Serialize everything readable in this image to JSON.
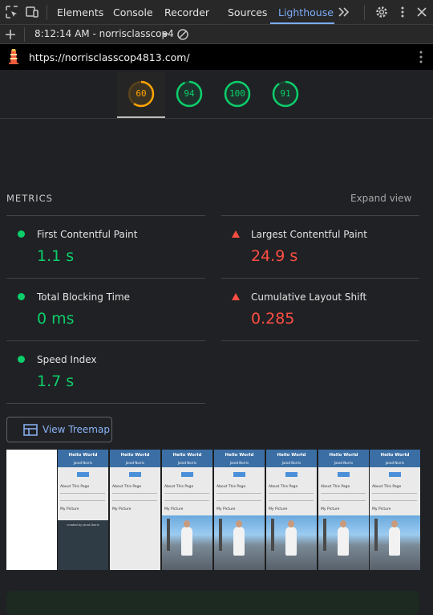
{
  "devtools": {
    "tabs": [
      {
        "label": "Elements"
      },
      {
        "label": "Console"
      },
      {
        "label": "Recorder"
      },
      {
        "label": "Sources"
      },
      {
        "label": "Lighthouse"
      }
    ],
    "active_tab": "Lighthouse",
    "report_selector": "8:12:14 AM - norrisclasscop4",
    "url": "https://norrisclasscop4813.com/"
  },
  "scores": [
    {
      "value": "60",
      "fraction": 0.6,
      "color": "#ffa400"
    },
    {
      "value": "94",
      "fraction": 0.94,
      "color": "#0cce6b"
    },
    {
      "value": "100",
      "fraction": 1.0,
      "color": "#0cce6b"
    },
    {
      "value": "91",
      "fraction": 0.91,
      "color": "#0cce6b"
    }
  ],
  "metrics": {
    "title": "METRICS",
    "expand_label": "Expand view",
    "items": [
      {
        "label": "First Contentful Paint",
        "value": "1.1 s",
        "status": "pass"
      },
      {
        "label": "Largest Contentful Paint",
        "value": "24.9 s",
        "status": "fail"
      },
      {
        "label": "Total Blocking Time",
        "value": "0 ms",
        "status": "pass"
      },
      {
        "label": "Cumulative Layout Shift",
        "value": "0.285",
        "status": "fail"
      },
      {
        "label": "Speed Index",
        "value": "1.7 s",
        "status": "pass"
      }
    ]
  },
  "treemap_button": "View Treemap",
  "filmstrip": {
    "title": "Hello World",
    "subtitle": "Jarod Norris",
    "about": "About This Page",
    "picture": "My Picture",
    "footer": "created by Jarod Norris"
  },
  "colors": {
    "pass": "#0cce6b",
    "fail": "#ff4e42",
    "average": "#ffa400",
    "accent": "#7cacf8"
  }
}
